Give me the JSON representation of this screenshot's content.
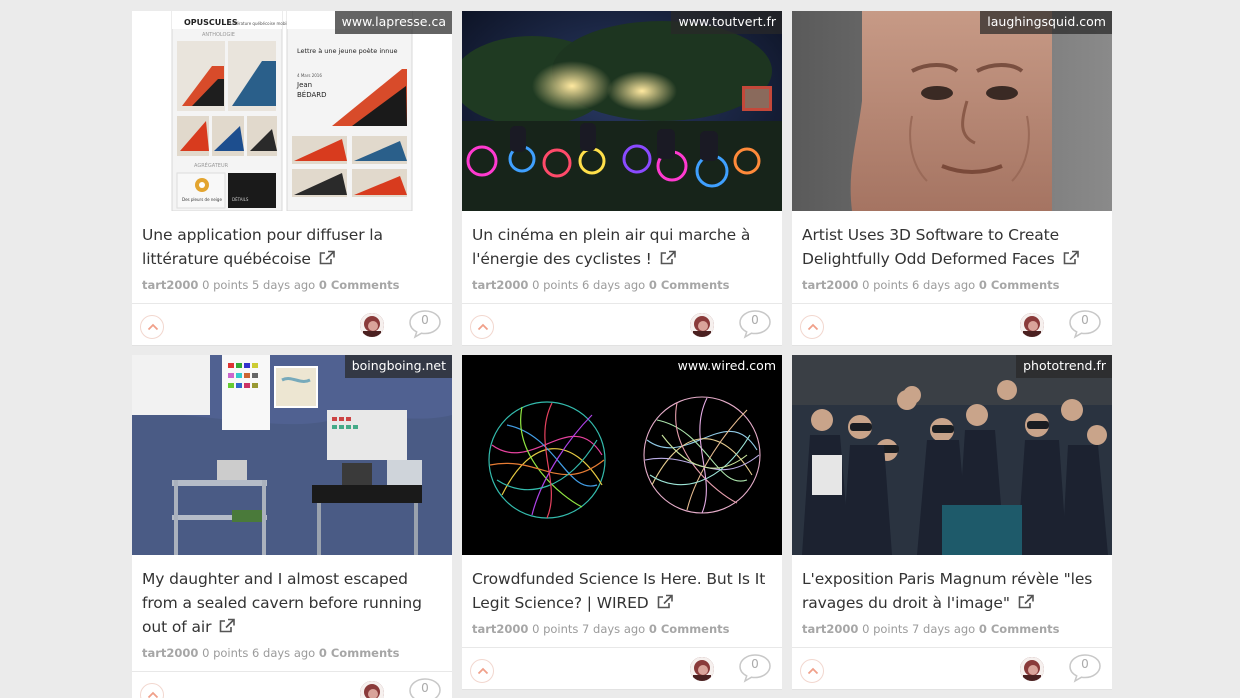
{
  "cards": [
    {
      "source": "www.lapresse.ca",
      "title": "Une application pour diffuser la littérature québécoise",
      "author": "tart2000",
      "points": "0 points",
      "age": "5 days ago",
      "comments": "0 Comments",
      "comment_count": "0",
      "thumb_text": {
        "app_name": "OPUSCULES",
        "app_tagline": "Littérature québécoise mobile",
        "section_top": "ANTHOLOGIE",
        "section_mid": "AGRÉGATEUR",
        "item_title": "Lettre à une jeune poète innue",
        "item_date": "4 Mars 2016",
        "item_author_first": "Jean",
        "item_author_last": "BÉDARD",
        "tile_label_a": "Des pleurs de neige",
        "tile_label_b": "DÉTAILS"
      }
    },
    {
      "source": "www.toutvert.fr",
      "title": "Un cinéma en plein air qui marche à l'énergie des cyclistes !",
      "author": "tart2000",
      "points": "0 points",
      "age": "6 days ago",
      "comments": "0 Comments",
      "comment_count": "0"
    },
    {
      "source": "laughingsquid.com",
      "title": "Artist Uses 3D Software to Create Delightfully Odd Deformed Faces",
      "author": "tart2000",
      "points": "0 points",
      "age": "6 days ago",
      "comments": "0 Comments",
      "comment_count": "0"
    },
    {
      "source": "boingboing.net",
      "title": "My daughter and I almost escaped from a sealed cavern before running out of air",
      "author": "tart2000",
      "points": "0 points",
      "age": "6 days ago",
      "comments": "0 Comments",
      "comment_count": "0"
    },
    {
      "source": "www.wired.com",
      "title": "Crowdfunded Science Is Here. But Is It Legit Science? | WIRED",
      "author": "tart2000",
      "points": "0 points",
      "age": "7 days ago",
      "comments": "0 Comments",
      "comment_count": "0"
    },
    {
      "source": "phototrend.fr",
      "title": "L'exposition Paris Magnum révèle \"les ravages du droit à l'image\"",
      "author": "tart2000",
      "points": "0 points",
      "age": "7 days ago",
      "comments": "0 Comments",
      "comment_count": "0"
    }
  ],
  "icons": {
    "external_link": "external-link-icon",
    "upvote": "chevron-up-icon",
    "comment": "speech-bubble-icon"
  },
  "colors": {
    "page_bg": "#ebebeb",
    "card_bg": "#ffffff",
    "title_text": "#333333",
    "meta_text": "#9b9b9b",
    "upvote_accent": "#f0a08a"
  }
}
